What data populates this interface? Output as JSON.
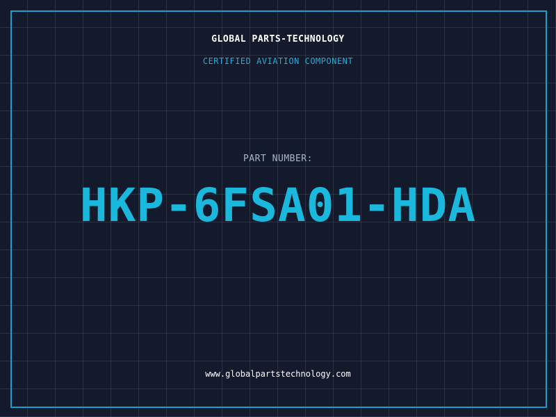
{
  "company": "GLOBAL PARTS-TECHNOLOGY",
  "subtitle": "CERTIFIED AVIATION COMPONENT",
  "part_label": "PART NUMBER:",
  "part_number": "HKP-6FSA01-HDA",
  "website": "www.globalpartstechnology.com",
  "colors": {
    "background": "#121a2c",
    "grid": "#1e7896",
    "frame": "#1a9fcf",
    "accent": "#1ab8dc"
  }
}
